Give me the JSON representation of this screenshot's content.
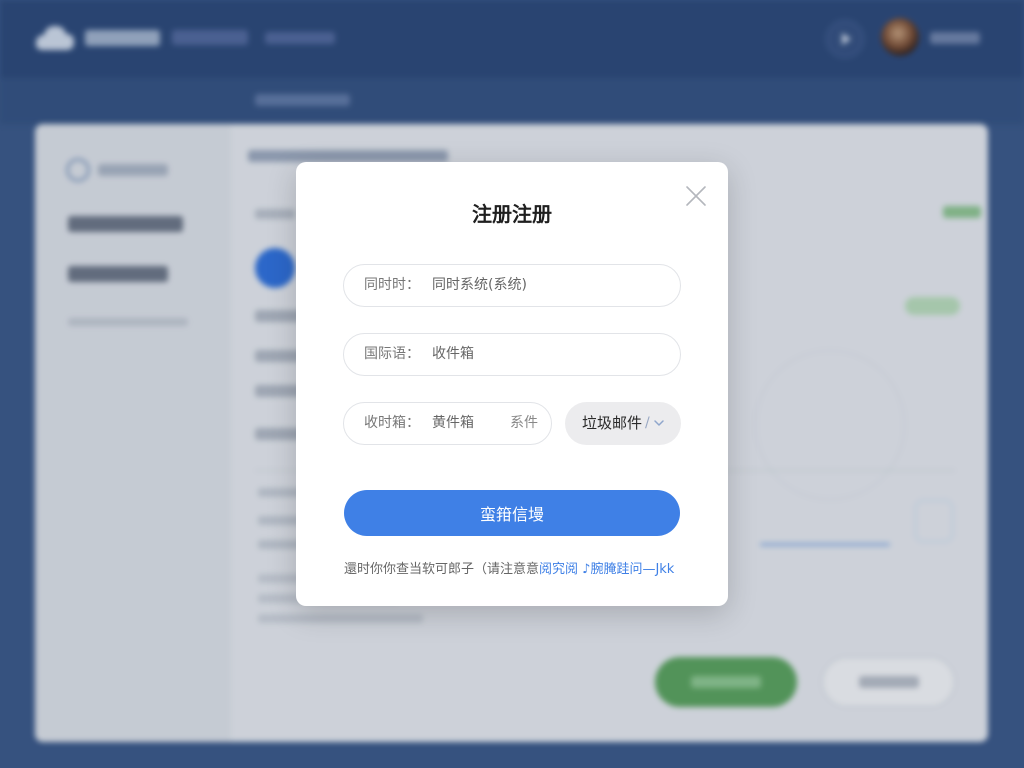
{
  "modal": {
    "title": "注册注册",
    "fields": [
      {
        "label": "同时时：",
        "value": "同时系统(系统)"
      },
      {
        "label": "国际语：",
        "value": "收件箱"
      },
      {
        "label": "收时箱：",
        "value": "黄件箱",
        "extra": "系件"
      }
    ],
    "select": {
      "value": "垃圾邮件",
      "separator": "/"
    },
    "submit_label": "蛮箝信墁",
    "footer": {
      "text": "還时你你查当软可郎子（请注意意",
      "link": "阅究阅 ♪腕腌跬问—Jkk"
    }
  },
  "icons": {
    "close": "close-icon",
    "select_chevron": "chevron-down-icon",
    "app_logo": "cloud-logo-icon",
    "header_action": "play-icon"
  },
  "colors": {
    "primary_blue": "#3f80e6",
    "header_blue": "#2c4877",
    "page_blue": "#3a5786",
    "green_action": "#5aa05c",
    "modal_bg": "#ffffff"
  }
}
